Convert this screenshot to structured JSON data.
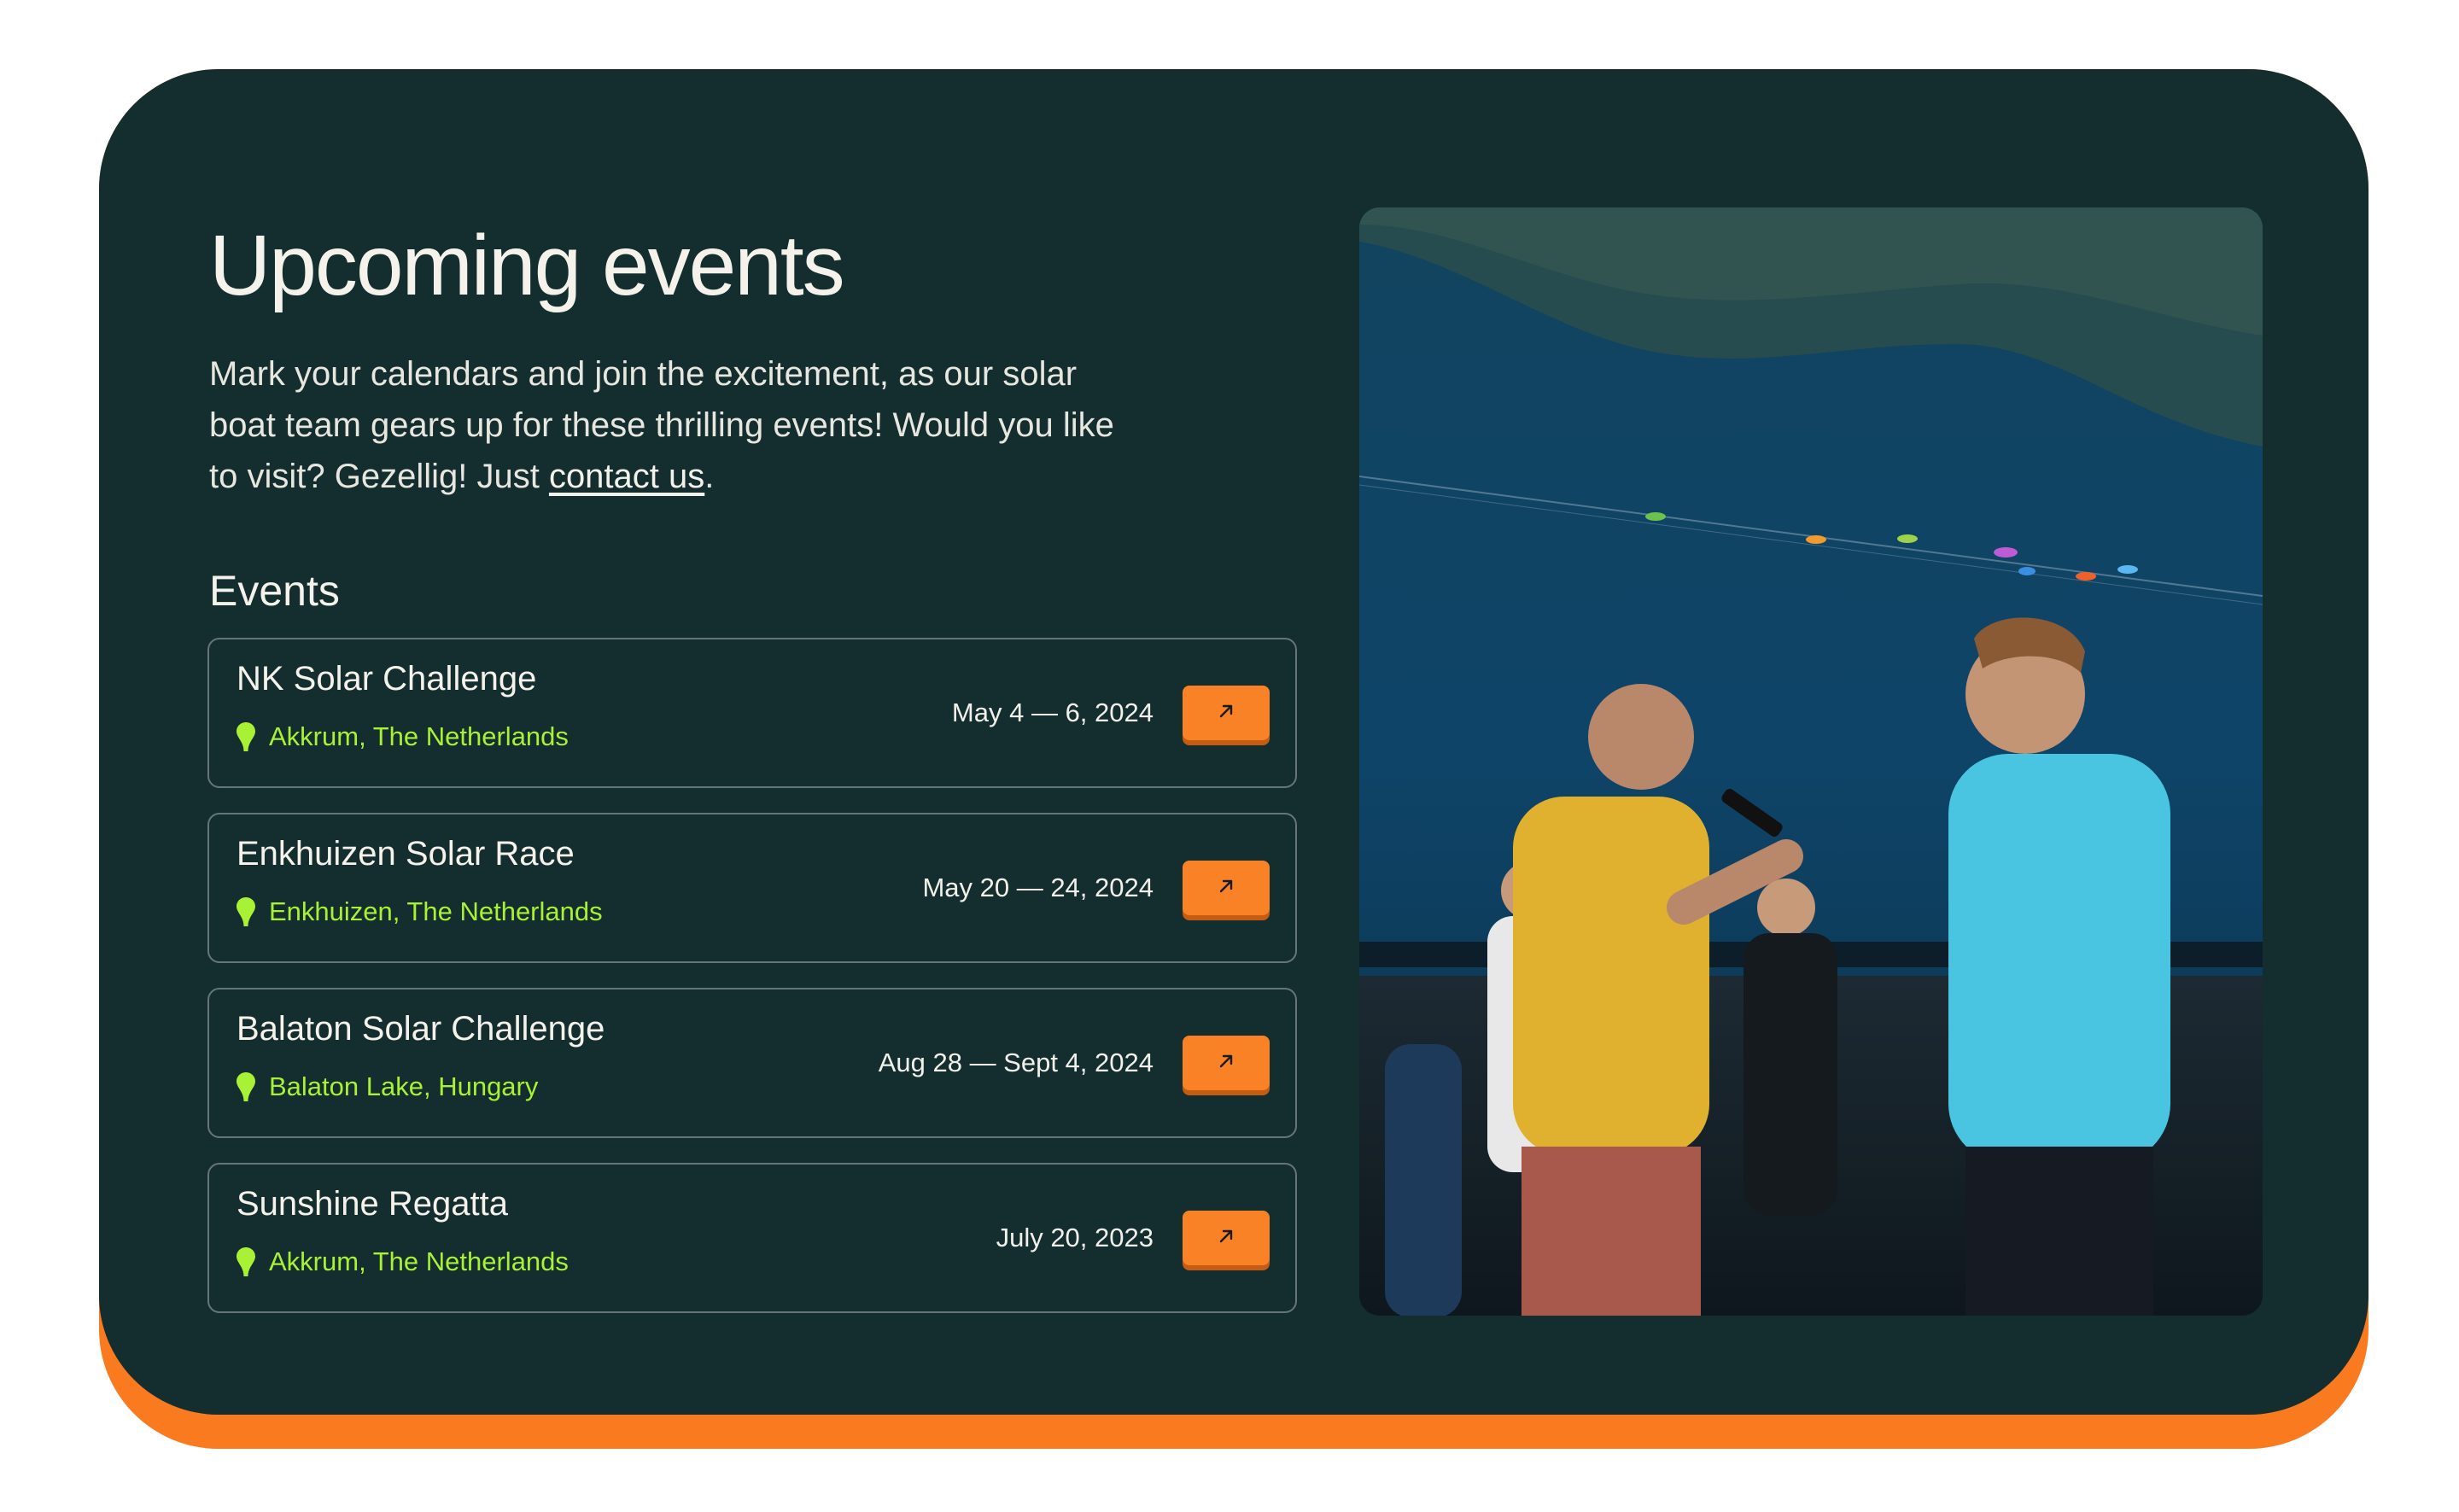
{
  "section": {
    "title": "Upcoming events",
    "intro_text": "Mark your calendars and join the excitement, as our solar boat team gears up for these thrilling events! Would you like to visit? Gezellig! Just ",
    "intro_link": "contact us",
    "intro_end": ".",
    "events_heading": "Events"
  },
  "events": [
    {
      "name": "NK Solar Challenge",
      "location": "Akkrum, The Netherlands",
      "date": "May 4 — 6, 2024"
    },
    {
      "name": "Enkhuizen Solar Race",
      "location": "Enkhuizen, The Netherlands",
      "date": "May 20 — 24, 2024"
    },
    {
      "name": "Balaton Solar Challenge",
      "location": "Balaton Lake, Hungary",
      "date": "Aug 28 — Sept 4, 2024"
    },
    {
      "name": "Sunshine Regatta",
      "location": "Akkrum, The Netherlands",
      "date": "July 20, 2023"
    }
  ],
  "icons": {
    "location": "map-pin-icon",
    "event_link": "arrow-up-right-icon"
  },
  "colors": {
    "background": "#ffffff",
    "card": "#142d2f",
    "accent_orange": "#f98227",
    "location_green": "#a8f135",
    "text": "#f4f2ea"
  }
}
